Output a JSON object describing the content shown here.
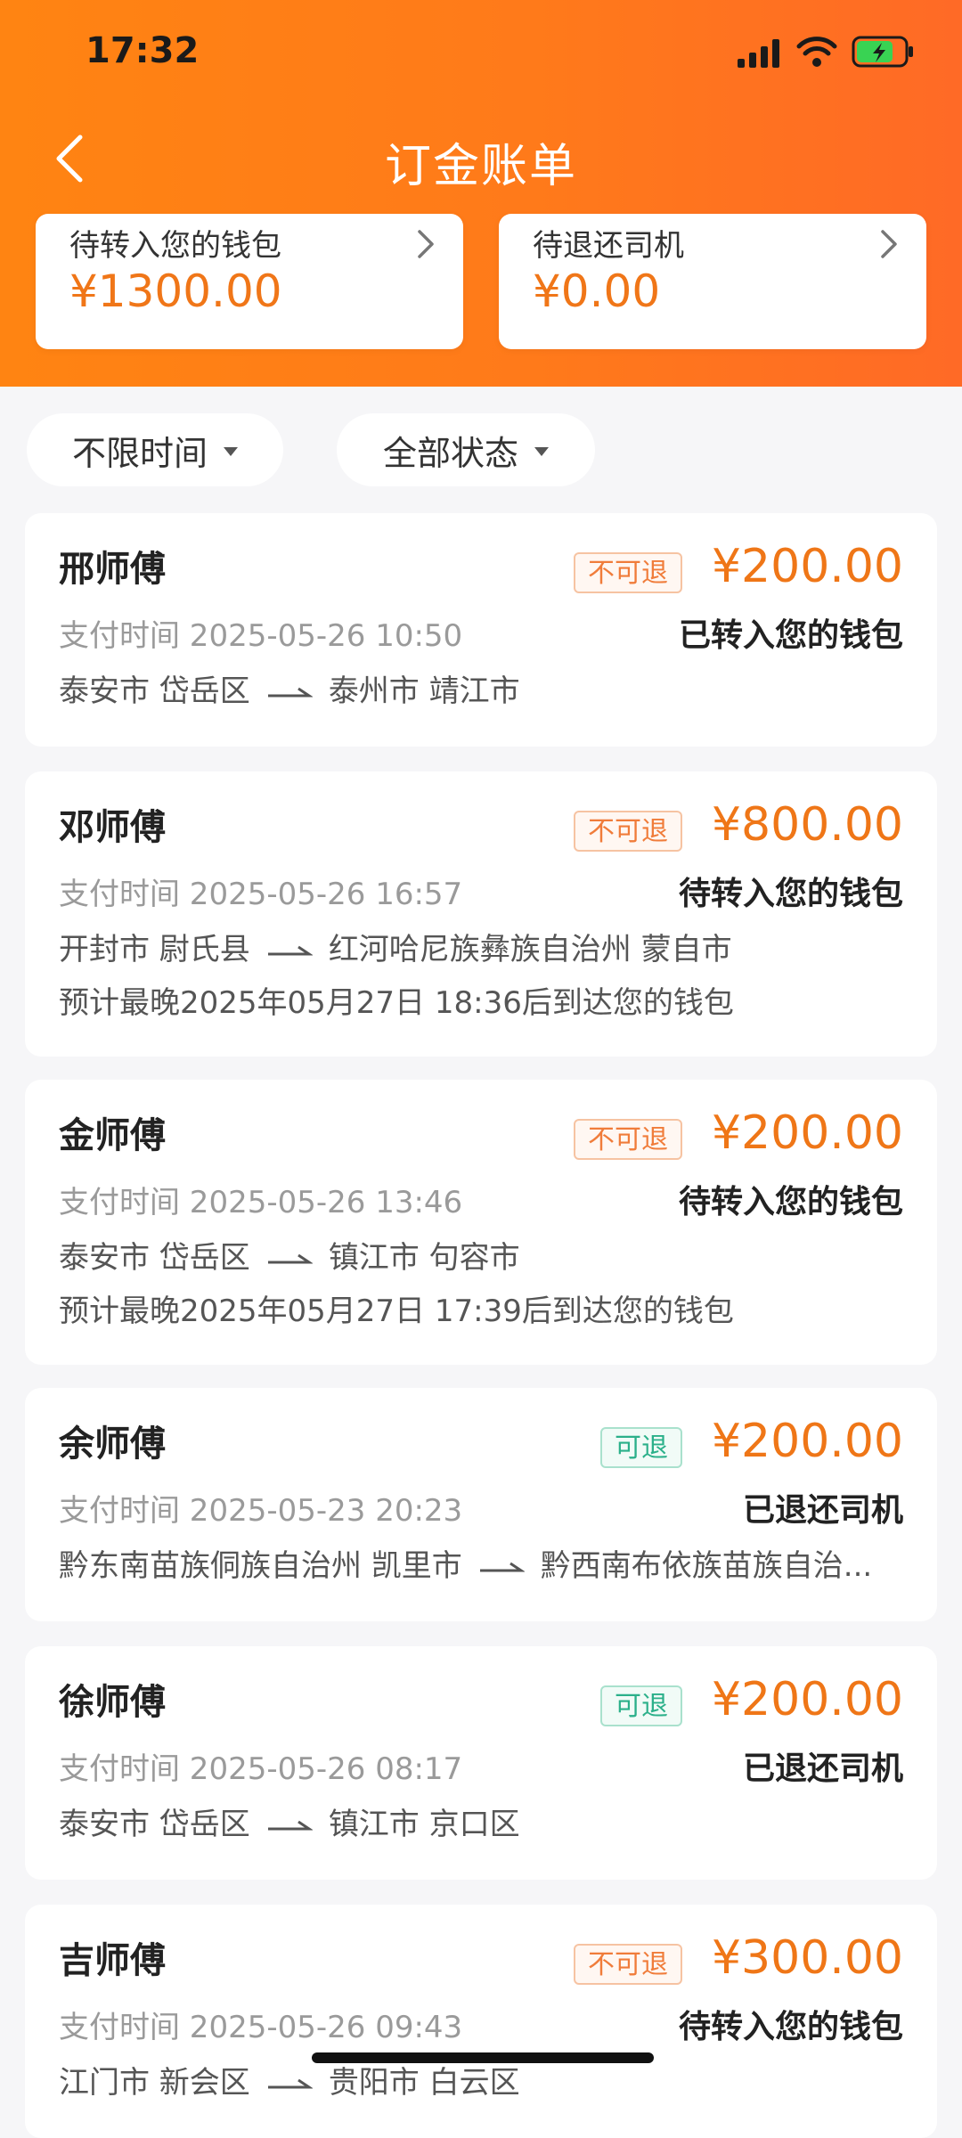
{
  "status_bar": {
    "time": "17:32"
  },
  "header": {
    "title": "订金账单"
  },
  "summary": {
    "pending_wallet": {
      "label": "待转入您的钱包",
      "amount": "¥1300.00"
    },
    "pending_refund": {
      "label": "待退还司机",
      "amount": "¥0.00"
    }
  },
  "filters": {
    "time": "不限时间",
    "status": "全部状态"
  },
  "orders": [
    {
      "driver": "邢师傅",
      "tag": "不可退",
      "amount": "¥200.00",
      "paytime": "支付时间 2025-05-26 10:50",
      "state": "已转入您的钱包",
      "from": "泰安市 岱岳区",
      "to": "泰州市 靖江市",
      "eta": ""
    },
    {
      "driver": "邓师傅",
      "tag": "不可退",
      "amount": "¥800.00",
      "paytime": "支付时间 2025-05-26 16:57",
      "state": "待转入您的钱包",
      "from": "开封市 尉氏县",
      "to": "红河哈尼族彝族自治州 蒙自市",
      "eta": "预计最晚2025年05月27日 18:36后到达您的钱包"
    },
    {
      "driver": "金师傅",
      "tag": "不可退",
      "amount": "¥200.00",
      "paytime": "支付时间 2025-05-26 13:46",
      "state": "待转入您的钱包",
      "from": "泰安市 岱岳区",
      "to": "镇江市 句容市",
      "eta": "预计最晚2025年05月27日 17:39后到达您的钱包"
    },
    {
      "driver": "余师傅",
      "tag": "可退",
      "amount": "¥200.00",
      "paytime": "支付时间 2025-05-23 20:23",
      "state": "已退还司机",
      "from": "黔东南苗族侗族自治州 凯里市",
      "to": "黔西南布依族苗族自治...",
      "eta": ""
    },
    {
      "driver": "徐师傅",
      "tag": "可退",
      "amount": "¥200.00",
      "paytime": "支付时间 2025-05-26 08:17",
      "state": "已退还司机",
      "from": "泰安市 岱岳区",
      "to": "镇江市 京口区",
      "eta": ""
    },
    {
      "driver": "吉师傅",
      "tag": "不可退",
      "amount": "¥300.00",
      "paytime": "支付时间 2025-05-26 09:43",
      "state": "待转入您的钱包",
      "from": "江门市 新会区",
      "to": "贵阳市 白云区",
      "eta": ""
    }
  ]
}
